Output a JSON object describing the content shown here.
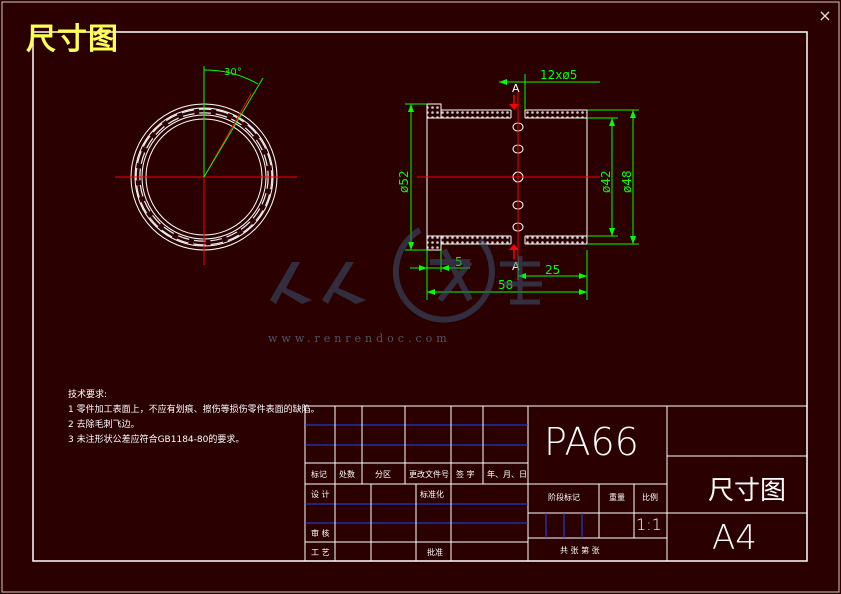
{
  "header": {
    "title": "尺寸图",
    "close_glyph": "×"
  },
  "notes": {
    "heading": "技术要求:",
    "items": [
      "1 零件加工表面上，不应有划痕、擦伤等损伤零件表面的缺陷。",
      "2 去除毛刺飞边。",
      "3 未注形状公差应符合GB1184-80的要求。"
    ]
  },
  "dimensions": {
    "angle": "30°",
    "holes": "12xø5",
    "section_top": "A",
    "section_bottom": "A",
    "outer_dia": "ø52",
    "inner_dia": "ø42",
    "body_dia": "ø48",
    "flange_len": "5",
    "half_len": "25",
    "total_len": "58"
  },
  "watermark": {
    "url": "www.renrendoc.com"
  },
  "title_block": {
    "material": "PA66",
    "drawing_name": "尺寸图",
    "sheet_size": "A4",
    "scale": "1:1",
    "hdr_mark": "标记",
    "hdr_count": "处数",
    "hdr_zone": "分区",
    "hdr_change_doc": "更改文件号",
    "hdr_sign": "签 字",
    "hdr_date": "年、月、日",
    "row_design": "设 计",
    "row_standard": "标准化",
    "row_review": "审 核",
    "row_process": "工 艺",
    "row_approve": "批准",
    "stage_mark": "阶段标记",
    "weight": "重量",
    "ratio": "比例",
    "sheets": "共   张   第   张"
  },
  "colors": {
    "background": "#2a0000",
    "outline": "#ffffff",
    "dimension": "#00ff00",
    "center": "#ff0000",
    "grid": "#2244ff",
    "title": "#ffff55"
  }
}
